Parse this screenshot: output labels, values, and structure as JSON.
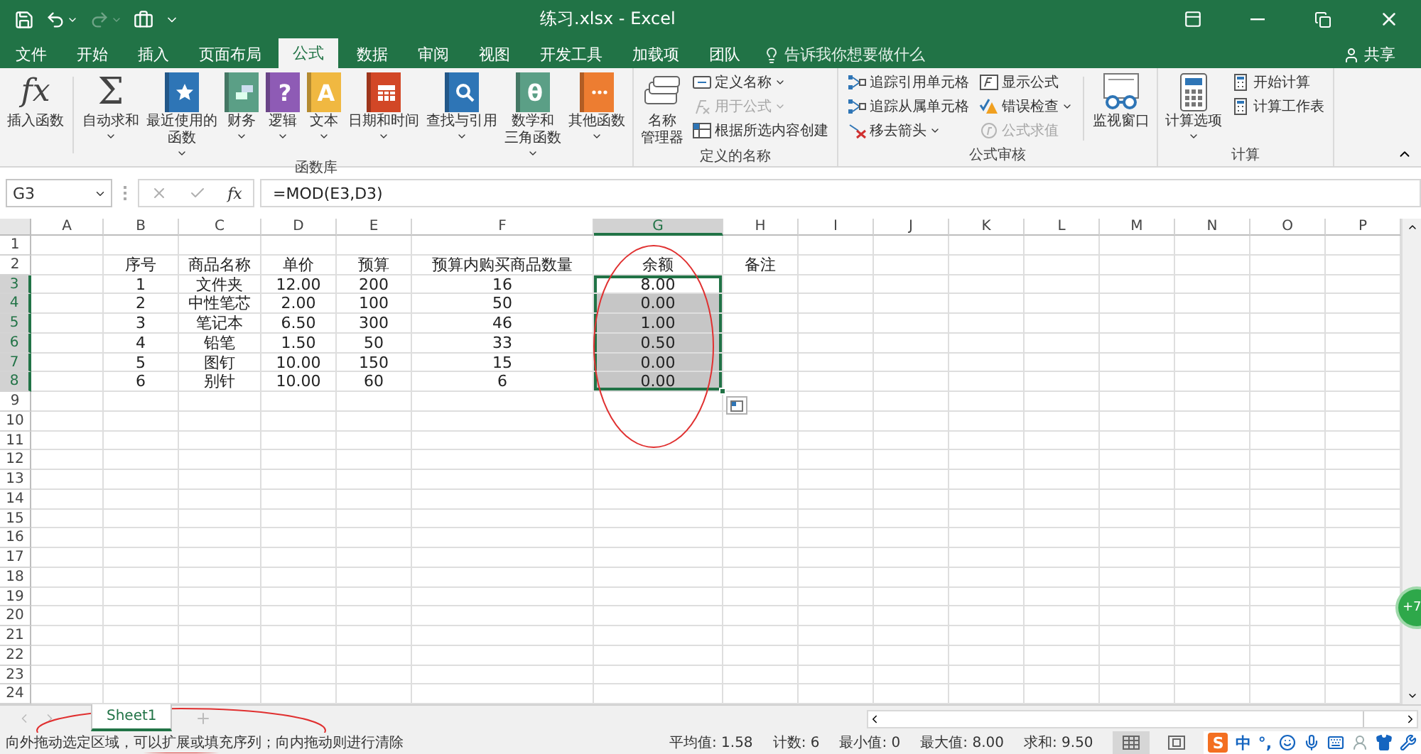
{
  "title_bar": {
    "title": "练习.xlsx  -  Excel",
    "quick_access": [
      {
        "kind": "save",
        "dropdown": false,
        "disabled": false
      },
      {
        "kind": "undo",
        "dropdown": true,
        "disabled": false
      },
      {
        "kind": "redo",
        "dropdown": true,
        "disabled": true
      },
      {
        "kind": "toolbox",
        "dropdown": false,
        "disabled": false
      },
      {
        "kind": "customize",
        "dropdown": false,
        "disabled": false
      }
    ]
  },
  "tabs": [
    {
      "label": "文件",
      "selected": false
    },
    {
      "label": "开始",
      "selected": false
    },
    {
      "label": "插入",
      "selected": false
    },
    {
      "label": "页面布局",
      "selected": false
    },
    {
      "label": "公式",
      "selected": true
    },
    {
      "label": "数据",
      "selected": false
    },
    {
      "label": "审阅",
      "selected": false
    },
    {
      "label": "视图",
      "selected": false
    },
    {
      "label": "开发工具",
      "selected": false
    },
    {
      "label": "加载项",
      "selected": false
    },
    {
      "label": "团队",
      "selected": false
    }
  ],
  "tell_me": {
    "placeholder": "告诉我你想要做什么"
  },
  "share": "共享",
  "ribbon": {
    "groups": [
      {
        "label": "函数库",
        "items": [
          {
            "kind": "function",
            "glyph": "fx",
            "label": [
              "插入函数"
            ],
            "dropdown": false
          },
          {
            "kind": "separator"
          },
          {
            "kind": "sigma",
            "glyph": "Σ",
            "label": [
              "自动求和"
            ],
            "dropdown": true
          },
          {
            "kind": "book_star",
            "color": "#2e75b6",
            "label": [
              "最近使用的",
              "函数"
            ],
            "dropdown": true
          },
          {
            "kind": "book_coins",
            "color": "#5b9f86",
            "label": [
              "财务"
            ],
            "dropdown": true
          },
          {
            "kind": "book",
            "glyph": "?",
            "color": "#8e5bb5",
            "label": [
              "逻辑"
            ],
            "dropdown": true
          },
          {
            "kind": "book",
            "glyph": "A",
            "color": "#f0b841",
            "label": [
              "文本"
            ],
            "dropdown": true
          },
          {
            "kind": "book_calendar",
            "color": "#d24726",
            "label": [
              "日期和时间"
            ],
            "dropdown": true
          },
          {
            "kind": "book_search",
            "color": "#2e75b6",
            "label": [
              "查找与引用"
            ],
            "dropdown": true
          },
          {
            "kind": "book",
            "glyph": "θ",
            "color": "#5b9f86",
            "label": [
              "数学和",
              "三角函数"
            ],
            "dropdown": true
          },
          {
            "kind": "book_dots",
            "color": "#ed7d31",
            "label": [
              "其他函数"
            ],
            "dropdown": true
          }
        ]
      },
      {
        "label": "定义的名称",
        "items": [
          {
            "kind": "name_manager",
            "label": [
              "名称",
              "管理器"
            ],
            "dropdown": false
          },
          {
            "kind": "stack",
            "items": [
              {
                "kind": "tag",
                "label": "定义名称",
                "dropdown": true,
                "disabled": false
              },
              {
                "kind": "formula",
                "label": "用于公式",
                "dropdown": true,
                "disabled": true
              },
              {
                "kind": "create",
                "label": "根据所选内容创建",
                "dropdown": false,
                "disabled": false
              }
            ]
          }
        ]
      },
      {
        "label": "公式审核",
        "items": [
          {
            "kind": "stack",
            "items": [
              {
                "kind": "trace",
                "label": "追踪引用单元格",
                "dropdown": false,
                "disabled": false
              },
              {
                "kind": "trace",
                "label": "追踪从属单元格",
                "dropdown": false,
                "disabled": false
              },
              {
                "kind": "remove",
                "label": "移去箭头",
                "dropdown": true,
                "disabled": false
              }
            ]
          },
          {
            "kind": "stack",
            "items": [
              {
                "kind": "show",
                "label": "显示公式",
                "dropdown": false,
                "disabled": false
              },
              {
                "kind": "error",
                "label": "错误检查",
                "dropdown": true,
                "disabled": false
              },
              {
                "kind": "evaluate",
                "label": "公式求值",
                "dropdown": false,
                "disabled": true
              }
            ]
          },
          {
            "kind": "separator"
          },
          {
            "kind": "watch",
            "label": [
              "监视窗口"
            ],
            "dropdown": false
          }
        ]
      },
      {
        "label": "计算",
        "items": [
          {
            "kind": "calculator",
            "label": [
              "计算选项"
            ],
            "dropdown": true
          },
          {
            "kind": "stack",
            "items": [
              {
                "kind": "calc",
                "label": "开始计算",
                "dropdown": false,
                "disabled": false
              },
              {
                "kind": "calc",
                "label": "计算工作表",
                "dropdown": false,
                "disabled": false
              }
            ]
          }
        ]
      }
    ]
  },
  "name_box": {
    "value": "G3"
  },
  "formula_bar": {
    "function_glyph": "fx",
    "value": "=MOD(E3,D3)"
  },
  "sheet": {
    "columns": [
      {
        "label": "A",
        "selected": false
      },
      {
        "label": "B",
        "selected": false
      },
      {
        "label": "C",
        "selected": false
      },
      {
        "label": "D",
        "selected": false
      },
      {
        "label": "E",
        "selected": false
      },
      {
        "label": "F",
        "selected": false
      },
      {
        "label": "G",
        "selected": true
      },
      {
        "label": "H",
        "selected": false
      },
      {
        "label": "I",
        "selected": false
      },
      {
        "label": "J",
        "selected": false
      },
      {
        "label": "K",
        "selected": false
      },
      {
        "label": "L",
        "selected": false
      },
      {
        "label": "M",
        "selected": false
      },
      {
        "label": "N",
        "selected": false
      },
      {
        "label": "O",
        "selected": false
      },
      {
        "label": "P",
        "selected": false
      }
    ],
    "rows": [
      {
        "header": "1",
        "selected": false
      },
      {
        "header": "2",
        "selected": false,
        "cells": [
          "序号",
          "商品名称",
          "单价",
          "预算",
          "预算内购买商品数量",
          "余额",
          "备注"
        ]
      },
      {
        "header": "3",
        "selected": true,
        "cells": [
          "1",
          "文件夹",
          "12.00",
          "200",
          "16",
          "8.00"
        ]
      },
      {
        "header": "4",
        "selected": true,
        "cells": [
          "2",
          "中性笔芯",
          "2.00",
          "100",
          "50",
          "0.00"
        ]
      },
      {
        "header": "5",
        "selected": true,
        "cells": [
          "3",
          "笔记本",
          "6.50",
          "300",
          "46",
          "1.00"
        ]
      },
      {
        "header": "6",
        "selected": true,
        "cells": [
          "4",
          "铅笔",
          "1.50",
          "50",
          "33",
          "0.50"
        ]
      },
      {
        "header": "7",
        "selected": true,
        "cells": [
          "5",
          "图钉",
          "10.00",
          "150",
          "15",
          "0.00"
        ]
      },
      {
        "header": "8",
        "selected": true,
        "cells": [
          "6",
          "别针",
          "10.00",
          "60",
          "6",
          "0.00"
        ]
      },
      {
        "header": "9",
        "selected": false
      },
      {
        "header": "10",
        "selected": false
      },
      {
        "header": "11",
        "selected": false
      },
      {
        "header": "12",
        "selected": false
      },
      {
        "header": "13",
        "selected": false
      },
      {
        "header": "14",
        "selected": false
      },
      {
        "header": "15",
        "selected": false
      },
      {
        "header": "16",
        "selected": false
      },
      {
        "header": "17",
        "selected": false
      },
      {
        "header": "18",
        "selected": false
      },
      {
        "header": "19",
        "selected": false
      },
      {
        "header": "20",
        "selected": false
      },
      {
        "header": "21",
        "selected": false
      },
      {
        "header": "22",
        "selected": false
      },
      {
        "header": "23",
        "selected": false
      },
      {
        "header": "24",
        "selected": false
      }
    ]
  },
  "sheet_tabs": [
    {
      "label": "Sheet1",
      "selected": true
    }
  ],
  "status_bar": {
    "message": "向外拖动选定区域，可以扩展或填充序列；向内拖动则进行清除",
    "stats": [
      "平均值: 1.58",
      "计数: 6",
      "最小值: 0",
      "最大值: 8.00",
      "求和: 9.50"
    ],
    "views": [
      {
        "kind": "normal",
        "selected": true
      },
      {
        "kind": "page_layout",
        "selected": false
      }
    ]
  },
  "ime": {
    "logo": "S",
    "items": [
      {
        "kind": "text",
        "text": "中"
      },
      {
        "kind": "text",
        "text": "°,"
      },
      {
        "kind": "emoji"
      },
      {
        "kind": "mic"
      },
      {
        "kind": "keyboard"
      },
      {
        "kind": "user"
      },
      {
        "kind": "shirt"
      },
      {
        "kind": "wrench"
      }
    ]
  },
  "floating_badge": "+7",
  "annotations": [
    {
      "kind": "ellipse"
    },
    {
      "kind": "ellipse"
    }
  ]
}
